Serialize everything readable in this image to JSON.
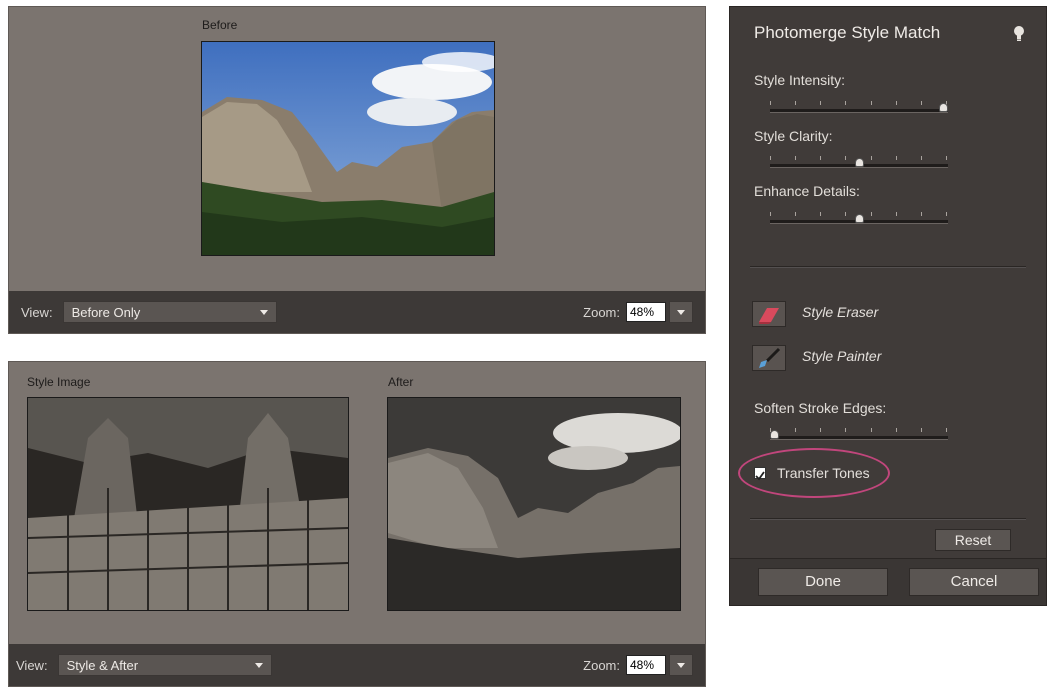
{
  "before_panel": {
    "label": "Before",
    "view_label": "View:",
    "view_value": "Before Only",
    "zoom_label": "Zoom:",
    "zoom_value": "48%"
  },
  "after_panel": {
    "style_label": "Style Image",
    "after_label": "After",
    "view_label": "View:",
    "view_value": "Style & After",
    "zoom_label": "Zoom:",
    "zoom_value": "48%"
  },
  "side_panel": {
    "title": "Photomerge Style Match",
    "help_icon": "lightbulb-icon",
    "style_intensity": {
      "label": "Style Intensity:",
      "value": 1.0
    },
    "style_clarity": {
      "label": "Style Clarity:",
      "value": 0.5
    },
    "enhance_details": {
      "label": "Enhance Details:",
      "value": 0.5
    },
    "style_eraser": {
      "label": "Style Eraser",
      "icon": "eraser-icon"
    },
    "style_painter": {
      "label": "Style Painter",
      "icon": "brush-icon"
    },
    "soften_stroke_edges": {
      "label": "Soften Stroke Edges:",
      "value": 0.0
    },
    "transfer_tones": {
      "label": "Transfer Tones",
      "checked": true
    },
    "reset_label": "Reset",
    "done_label": "Done",
    "cancel_label": "Cancel"
  },
  "colors": {
    "panel_bg": "#7b746f",
    "side_bg": "#403b39",
    "highlight": "#c1467c"
  }
}
